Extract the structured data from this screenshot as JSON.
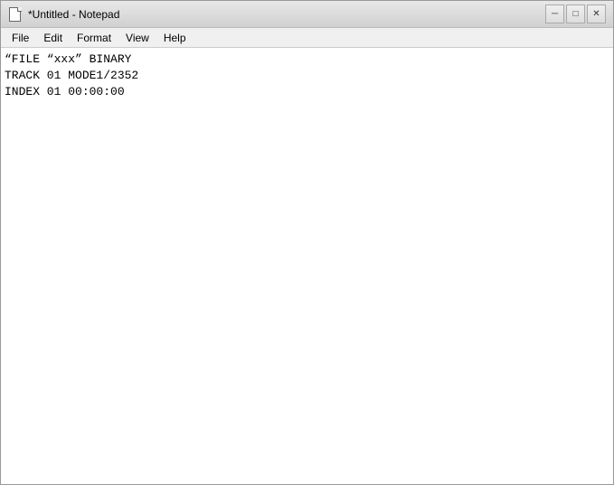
{
  "window": {
    "title": "*Untitled - Notepad",
    "icon": "document-icon"
  },
  "titlebar": {
    "minimize_label": "─",
    "maximize_label": "□",
    "close_label": "✕"
  },
  "menubar": {
    "items": [
      {
        "id": "file",
        "label": "File"
      },
      {
        "id": "edit",
        "label": "Edit"
      },
      {
        "id": "format",
        "label": "Format"
      },
      {
        "id": "view",
        "label": "View"
      },
      {
        "id": "help",
        "label": "Help"
      }
    ]
  },
  "editor": {
    "content": "“FILE “xxx” BINARY\nTRACK 01 MODE1/2352\nINDEX 01 00:00:00\n"
  }
}
